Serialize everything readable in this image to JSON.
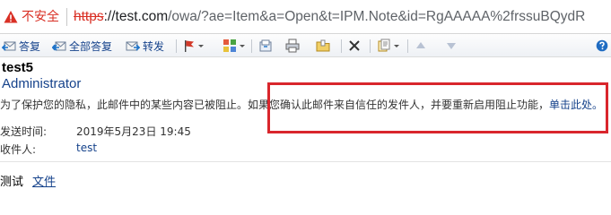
{
  "address_bar": {
    "security_label": "不安全",
    "url_scheme": "https",
    "url_host": "://test.com",
    "url_path": "/owa/?ae=Item&a=Open&t=IPM.Note&id=RgAAAAA%2frssuBQydR"
  },
  "toolbar": {
    "reply_label": "答复",
    "reply_all_label": "全部答复",
    "forward_label": "转发"
  },
  "message": {
    "subject": "test5",
    "sender": "Administrator",
    "block_notice": "为了保护您的隐私，此邮件中的某些内容已被阻止。如果您确认此邮件来自信任的发件人，并要重新启用阻止功能，",
    "block_link": "单击此处。",
    "sent_label": "发送时间:",
    "sent_value": "2019年5月23日 19:45",
    "to_label": "收件人:",
    "to_value": "test",
    "body_text": "测试",
    "attachment_label": "文件"
  },
  "colors": {
    "link": "#15428b",
    "highlight_box": "#d9262c",
    "insecure": "#d93025"
  }
}
